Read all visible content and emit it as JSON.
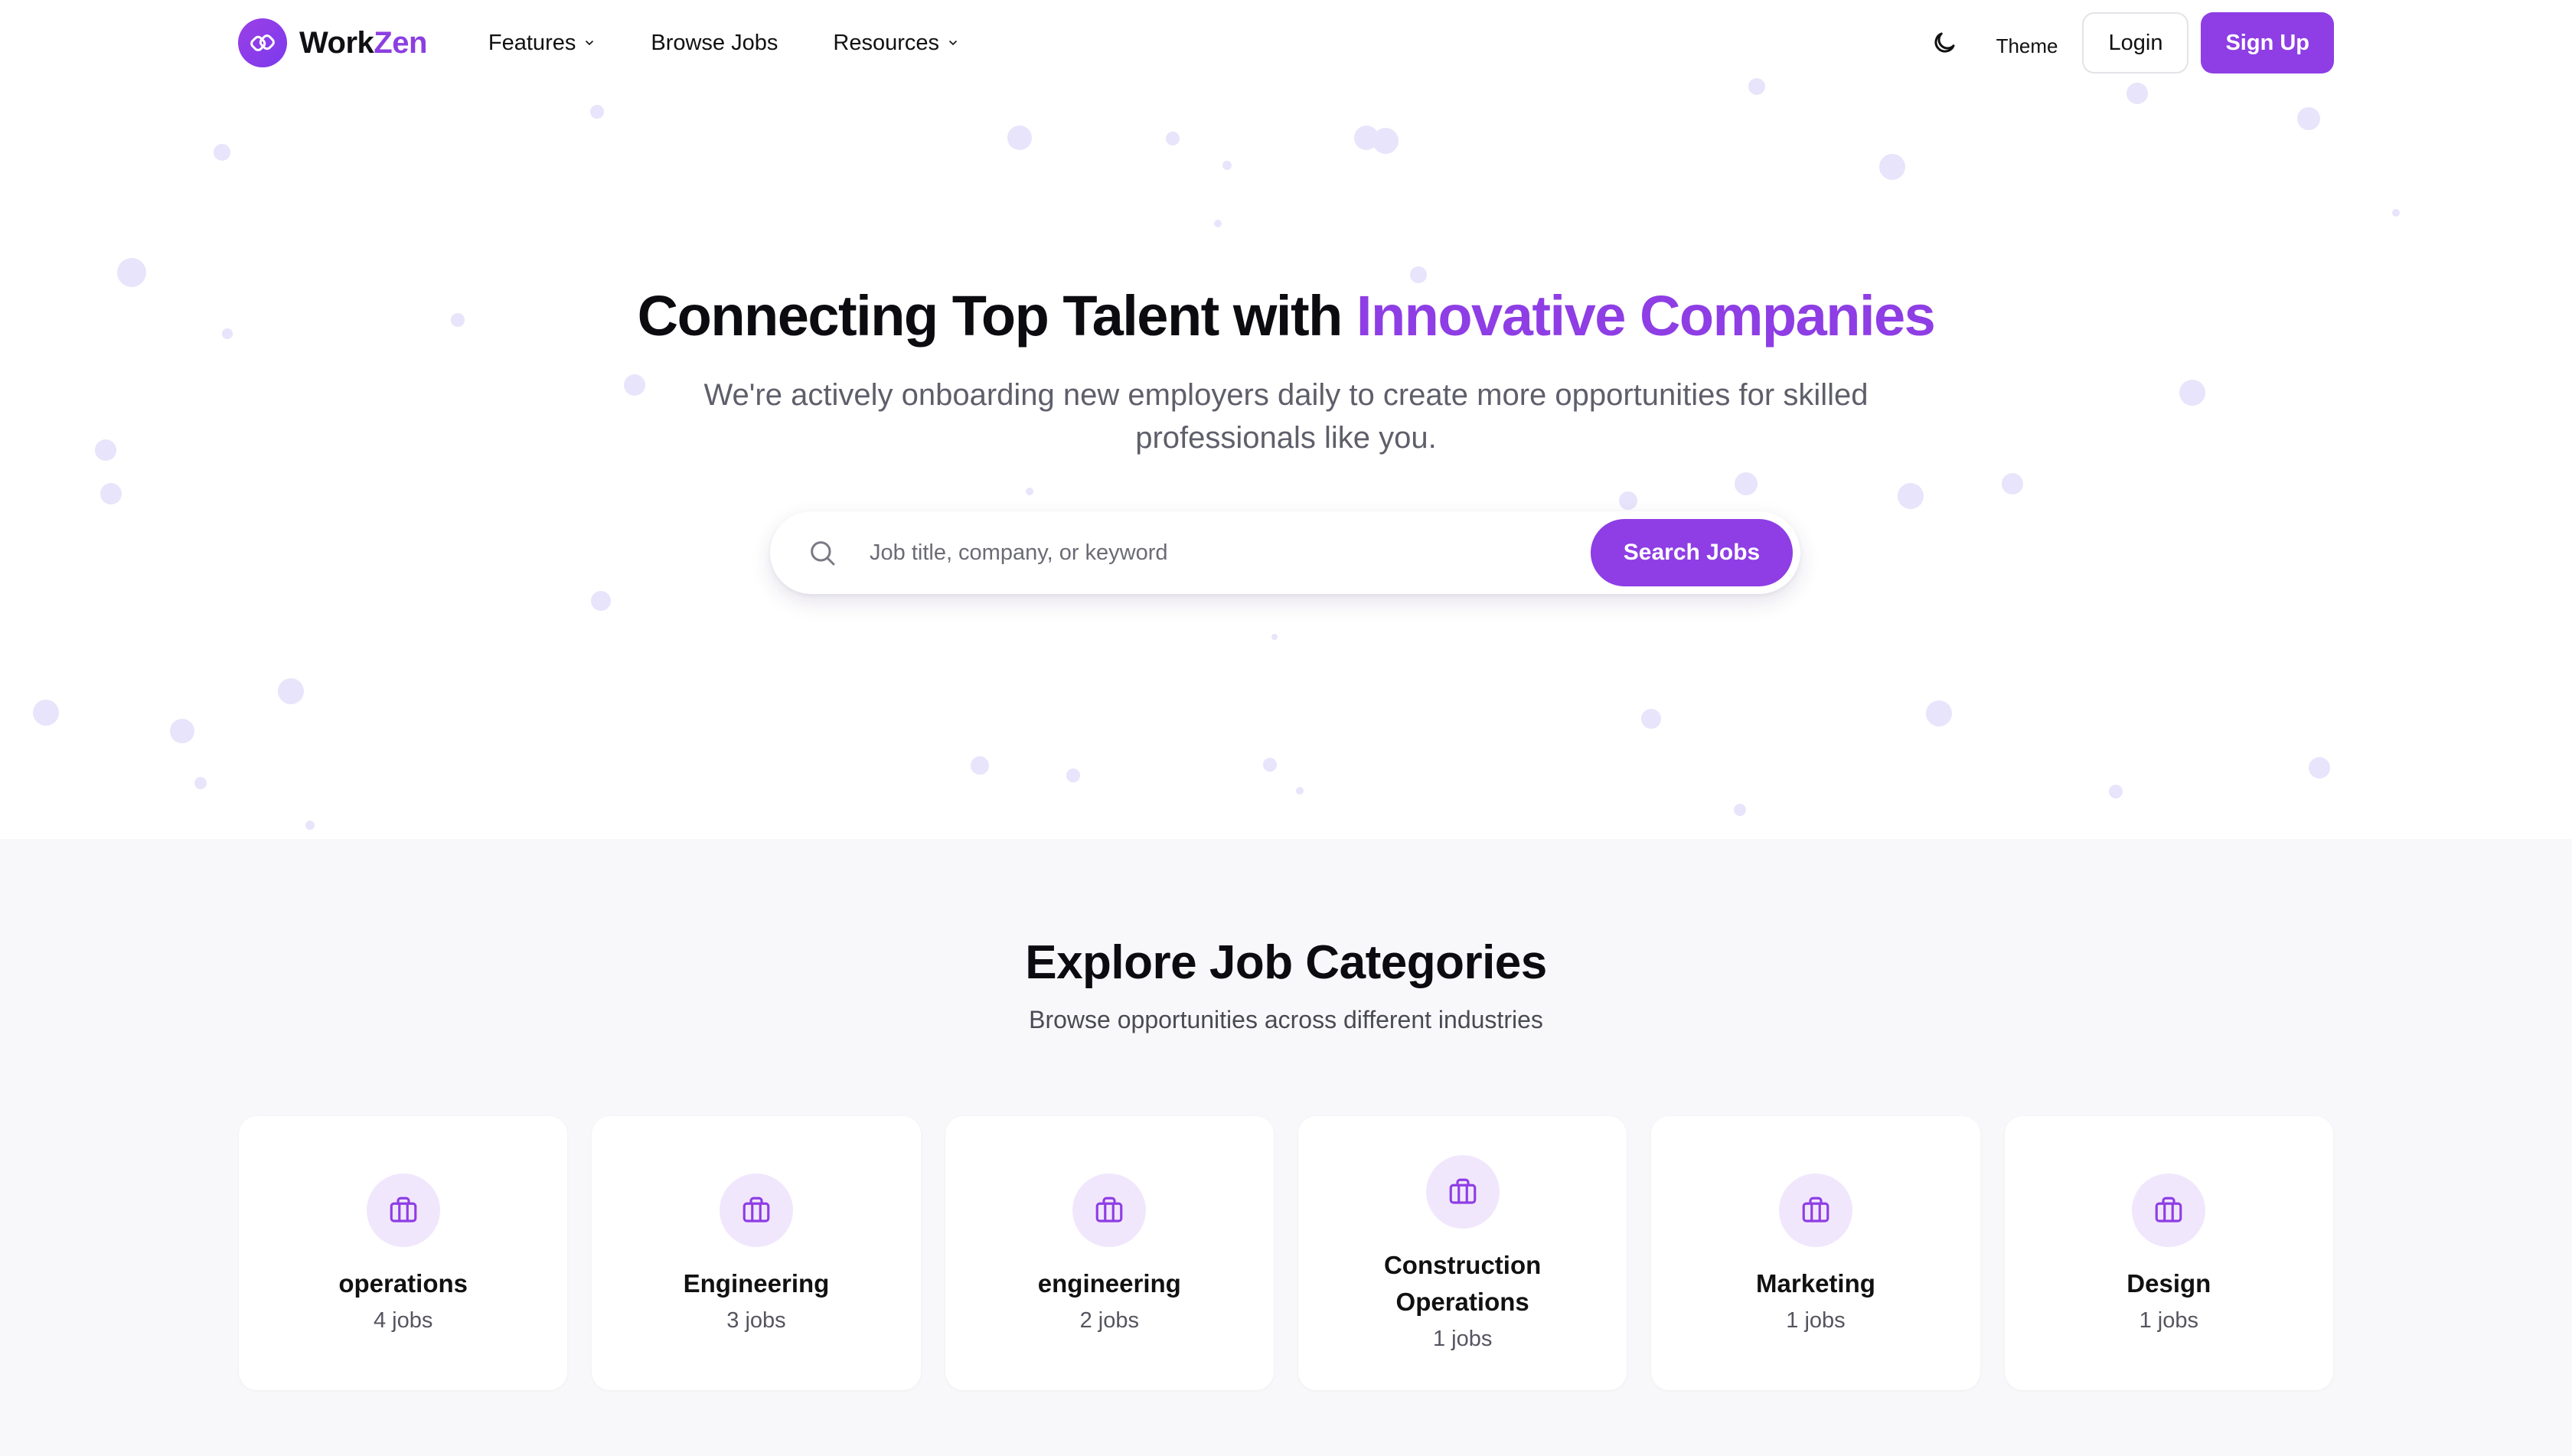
{
  "brand": {
    "name_part1": "Work",
    "name_part2": "Zen",
    "logo_icon": "workzen-logo-icon"
  },
  "nav": {
    "links": [
      {
        "label": "Features",
        "has_dropdown": true
      },
      {
        "label": "Browse Jobs",
        "has_dropdown": false
      },
      {
        "label": "Resources",
        "has_dropdown": true
      }
    ],
    "theme_label": "Theme",
    "theme_icon": "moon-icon",
    "login_label": "Login",
    "signup_label": "Sign Up"
  },
  "hero": {
    "title_plain": "Connecting Top Talent with ",
    "title_accent": "Innovative Companies",
    "subtitle": "We're actively onboarding new employers daily to create more opportunities for skilled professionals like you.",
    "search": {
      "placeholder": "Job title, company, or keyword",
      "value": "",
      "button_label": "Search Jobs"
    }
  },
  "categories": {
    "title": "Explore Job Categories",
    "subtitle": "Browse opportunities across different industries",
    "items": [
      {
        "name": "operations",
        "count": "4 jobs",
        "icon": "briefcase-icon"
      },
      {
        "name": "Engineering",
        "count": "3 jobs",
        "icon": "briefcase-icon"
      },
      {
        "name": "engineering",
        "count": "2 jobs",
        "icon": "briefcase-icon"
      },
      {
        "name": "Construction Operations",
        "count": "1 jobs",
        "icon": "briefcase-icon"
      },
      {
        "name": "Marketing",
        "count": "1 jobs",
        "icon": "briefcase-icon"
      },
      {
        "name": "Design",
        "count": "1 jobs",
        "icon": "briefcase-icon"
      }
    ]
  },
  "colors": {
    "accent": "#8e3ee4",
    "icon_bg": "#f1e7fc",
    "section_bg": "#f8f8fa",
    "particle": "#e6e3fb"
  }
}
